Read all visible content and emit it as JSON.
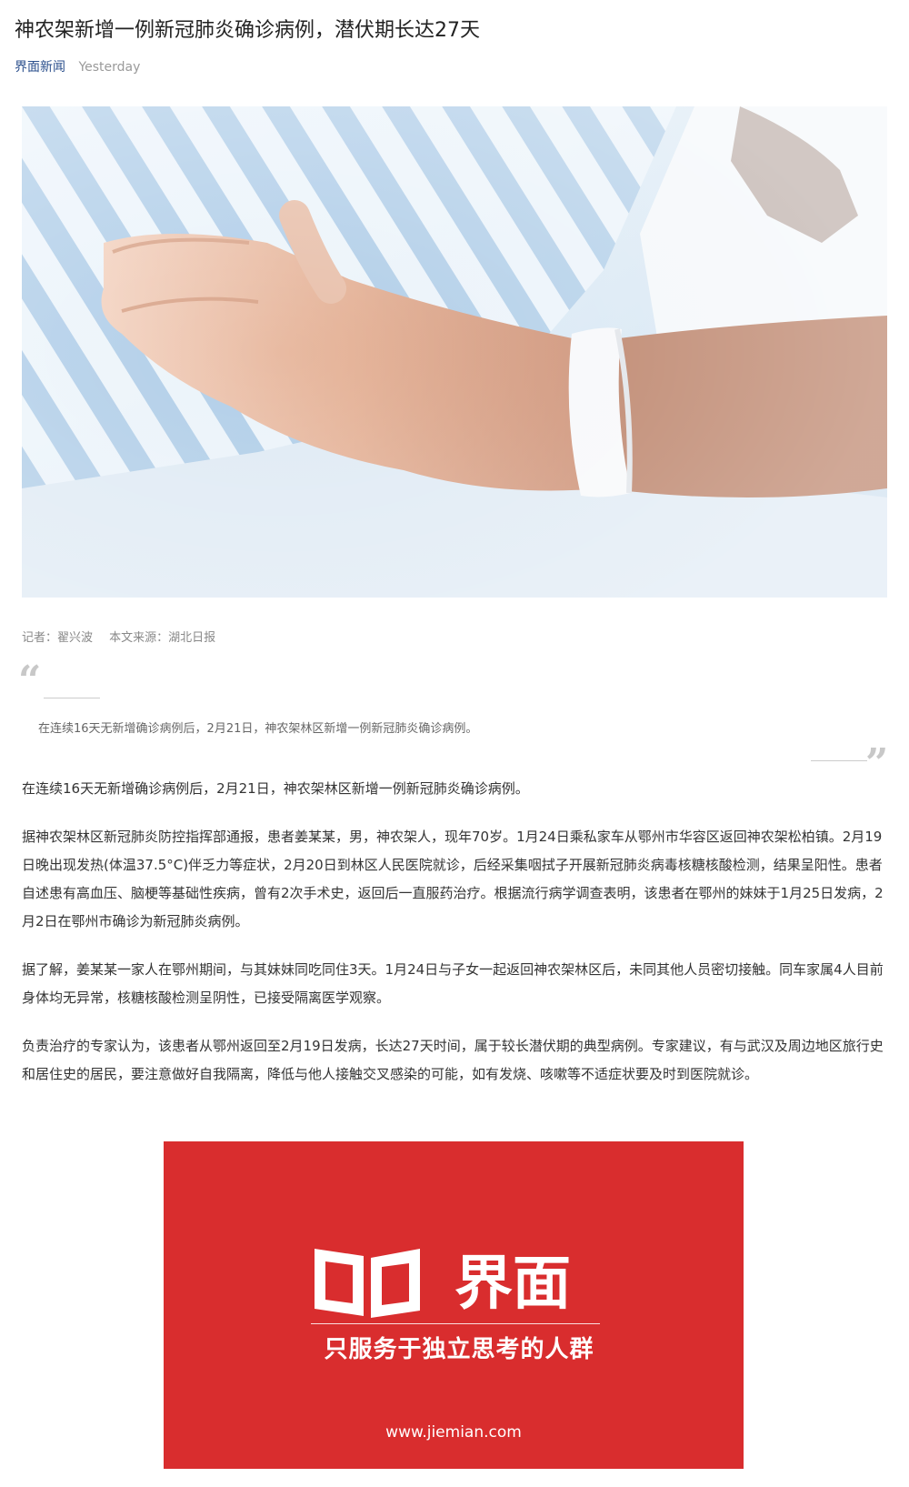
{
  "article": {
    "title": "神农架新增一例新冠肺炎确诊病例，潜伏期长达27天",
    "source": "界面新闻",
    "date": "Yesterday",
    "byline": {
      "reporter": "记者：翟兴波",
      "origin": "本文来源：湖北日报"
    },
    "quote": "在连续16天无新增确诊病例后，2月21日，神农架林区新增一例新冠肺炎确诊病例。",
    "paragraphs": [
      "在连续16天无新增确诊病例后，2月21日，神农架林区新增一例新冠肺炎确诊病例。",
      "据神农架林区新冠肺炎防控指挥部通报，患者姜某某，男，神农架人，现年70岁。1月24日乘私家车从鄂州市华容区返回神农架松柏镇。2月19日晚出现发热(体温37.5°C)伴乏力等症状，2月20日到林区人民医院就诊，后经采集咽拭子开展新冠肺炎病毒核糖核酸检测，结果呈阳性。患者自述患有高血压、脑梗等基础性疾病，曾有2次手术史，返回后一直服药治疗。根据流行病学调查表明，该患者在鄂州的妹妹于1月25日发病，2月2日在鄂州市确诊为新冠肺炎病例。",
      "据了解，姜某某一家人在鄂州期间，与其妹妹同吃同住3天。1月24日与子女一起返回神农架林区后，未同其他人员密切接触。同车家属4人目前身体均无异常，核糖核酸检测呈阴性，已接受隔离医学观察。",
      "负责治疗的专家认为，该患者从鄂州返回至2月19日发病，长达27天时间，属于较长潜伏期的典型病例。专家建议，有与武汉及周边地区旅行史和居住史的居民，要注意做好自我隔离，降低与他人接触交叉感染的可能，如有发烧、咳嗽等不适症状要及时到医院就诊。"
    ]
  },
  "ad": {
    "brand": "界面",
    "slogan": "只服务于独立思考的人群",
    "url": "www.jiemian.com",
    "background_color": "#d92d2e"
  },
  "colors": {
    "source_link": "#2b4f8c",
    "muted": "#9a9a9a",
    "body_text": "#333333"
  }
}
